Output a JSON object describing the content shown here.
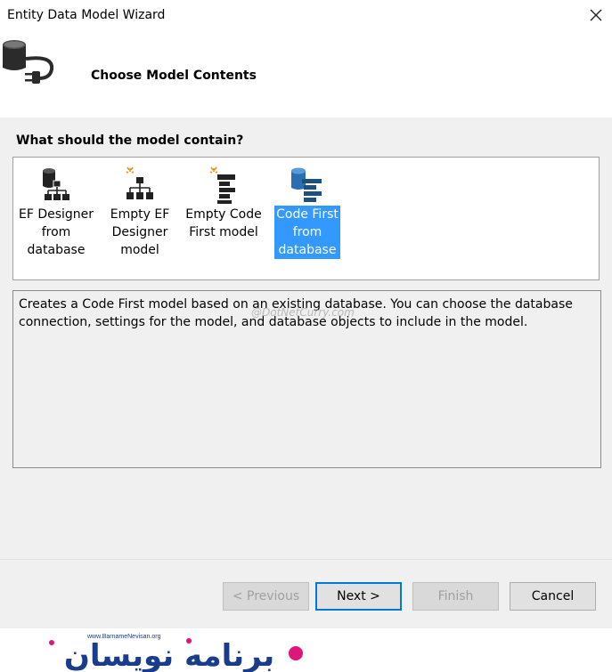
{
  "window": {
    "title": "Entity Data Model Wizard",
    "close_icon": "close-icon"
  },
  "header": {
    "title": "Choose Model Contents",
    "icon": "database-plug-icon"
  },
  "question": "What should the model contain?",
  "options": [
    {
      "label": "EF Designer\nfrom\ndatabase",
      "icon": "database-hierarchy-icon",
      "selected": false
    },
    {
      "label": "Empty EF\nDesigner\nmodel",
      "icon": "empty-hierarchy-icon",
      "selected": false
    },
    {
      "label": "Empty Code\nFirst model",
      "icon": "empty-code-icon",
      "selected": false
    },
    {
      "label": "Code First\nfrom\ndatabase",
      "icon": "database-code-icon",
      "selected": true
    }
  ],
  "description": "Creates a Code First model based on an existing database. You can choose the database connection, settings for the model, and database objects to include in the model.",
  "watermark": "@DotNetCurry.com",
  "buttons": {
    "previous": "< Previous",
    "next": "Next >",
    "finish": "Finish",
    "cancel": "Cancel"
  },
  "brand": {
    "site": "www.BarnameNevisan.org",
    "logo_text": "برنامه نویسان"
  },
  "colors": {
    "selection": "#3399ff",
    "accent": "#0078d7",
    "brand_blue": "#1a3c8c",
    "brand_pink": "#e0157a"
  }
}
